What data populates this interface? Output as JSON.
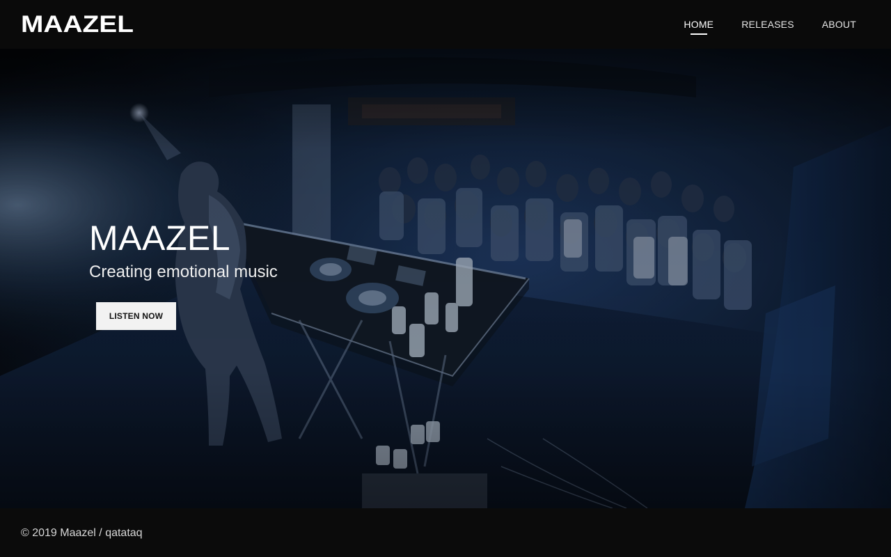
{
  "header": {
    "logo_text": "MAAZEL",
    "nav": [
      {
        "label": "HOME",
        "active": true
      },
      {
        "label": "RELEASES",
        "active": false
      },
      {
        "label": "ABOUT",
        "active": false
      }
    ]
  },
  "hero": {
    "title": "MAAZEL",
    "subtitle": "Creating emotional music",
    "cta_label": "LISTEN NOW",
    "image_description": "dj-performing-to-crowd-photo"
  },
  "footer": {
    "copyright": "© 2019 Maazel / qatataq"
  },
  "colors": {
    "header_bg": "#0a0a0a",
    "footer_bg": "#0b0b0b",
    "hero_tint": "#1c3a6e",
    "cta_bg": "#f2f2f2",
    "cta_text": "#111111",
    "nav_text": "#e6e6e6"
  }
}
